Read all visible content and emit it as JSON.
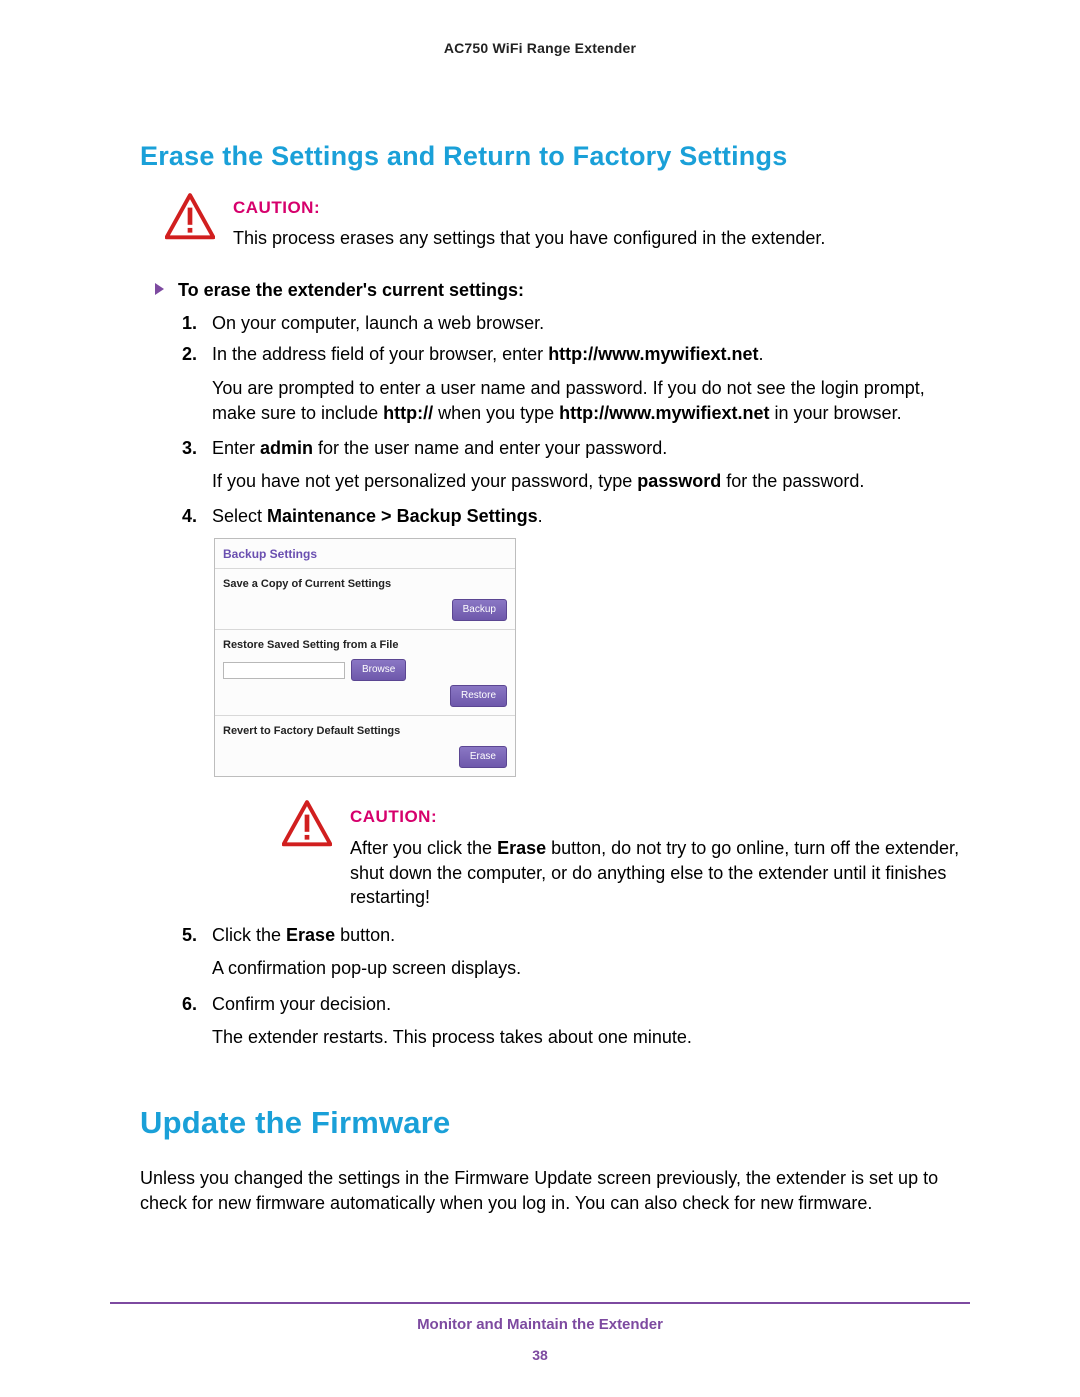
{
  "doc_header": "AC750 WiFi Range Extender",
  "section1_title": "Erase the Settings and Return to Factory Settings",
  "caution1": {
    "label": "CAUTION:",
    "body": "This process erases any settings that you have configured in the extender."
  },
  "procedure_intro": "To erase the extender's current settings:",
  "steps": {
    "s1": {
      "num": "1.",
      "text": "On your computer, launch a web browser."
    },
    "s2": {
      "num": "2.",
      "lead": "In the address field of your browser, enter ",
      "url1": "http://www.mywifiext.net",
      "period": ".",
      "p_a": "You are prompted to enter a user name and password. If you do not see the login prompt, make sure to include ",
      "p_b": "http://",
      "p_c": " when you type ",
      "p_d": "http://www.mywifiext.net",
      "p_e": " in your browser."
    },
    "s3": {
      "num": "3.",
      "lead": "Enter ",
      "admin": "admin",
      "mid": " for the user name and enter your password.",
      "p_a": "If you have not yet personalized your password, type ",
      "p_b": "password",
      "p_c": " for the password."
    },
    "s4": {
      "num": "4.",
      "lead": "Select ",
      "path": "Maintenance > Backup Settings",
      "period": "."
    },
    "s5": {
      "num": "5.",
      "lead": "Click the ",
      "erase": "Erase",
      "trail": " button.",
      "p": "A confirmation pop-up screen displays."
    },
    "s6": {
      "num": "6.",
      "text": "Confirm your decision.",
      "p": "The extender restarts. This process takes about one minute."
    }
  },
  "ui": {
    "panel_title": "Backup Settings",
    "save_label": "Save a Copy of Current Settings",
    "backup_btn": "Backup",
    "restore_label": "Restore Saved Setting from a File",
    "browse_btn": "Browse",
    "restore_btn": "Restore",
    "revert_label": "Revert to Factory Default Settings",
    "erase_btn": "Erase"
  },
  "caution2": {
    "label": "CAUTION:",
    "body_a": "After you click the ",
    "body_b": "Erase",
    "body_c": " button, do not try to go online, turn off the extender, shut down the computer, or do anything else to the extender until it finishes restarting!"
  },
  "section2_title": "Update the Firmware",
  "section2_body": "Unless you changed the settings in the Firmware Update screen previously, the extender is set up to check for new firmware automatically when you log in. You can also check for new firmware.",
  "footer": {
    "title": "Monitor and Maintain the Extender",
    "page": "38"
  }
}
